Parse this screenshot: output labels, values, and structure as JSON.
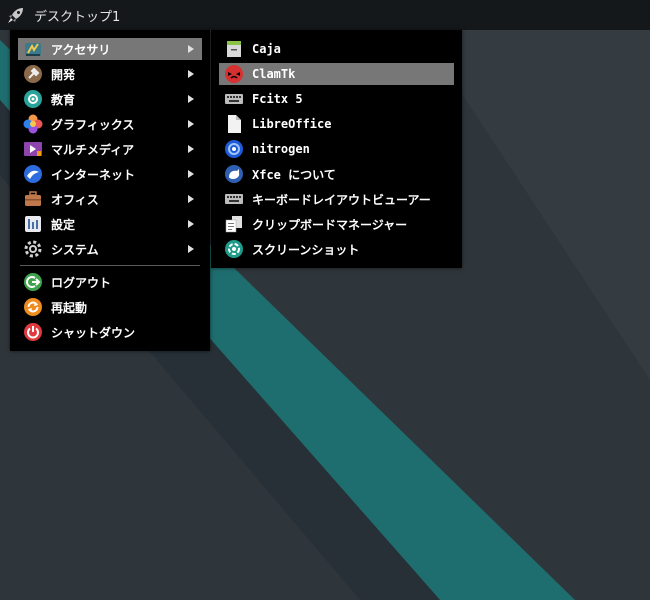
{
  "taskbar": {
    "title": "デスクトップ1",
    "icon": "rocket-icon"
  },
  "main_menu": {
    "items": [
      {
        "label": "アクセサリ",
        "icon": "accessories-icon",
        "submenu": true,
        "highlighted": true
      },
      {
        "label": "開発",
        "icon": "development-icon",
        "submenu": true
      },
      {
        "label": "教育",
        "icon": "education-icon",
        "submenu": true
      },
      {
        "label": "グラフィックス",
        "icon": "graphics-icon",
        "submenu": true
      },
      {
        "label": "マルチメディア",
        "icon": "multimedia-icon",
        "submenu": true
      },
      {
        "label": "インターネット",
        "icon": "internet-icon",
        "submenu": true
      },
      {
        "label": "オフィス",
        "icon": "office-icon",
        "submenu": true
      },
      {
        "label": "設定",
        "icon": "settings-icon",
        "submenu": true
      },
      {
        "label": "システム",
        "icon": "system-icon",
        "submenu": true
      }
    ],
    "session": [
      {
        "label": "ログアウト",
        "icon": "logout-icon"
      },
      {
        "label": "再起動",
        "icon": "restart-icon"
      },
      {
        "label": "シャットダウン",
        "icon": "shutdown-icon"
      }
    ]
  },
  "sub_menu": {
    "items": [
      {
        "label": "Caja",
        "icon": "file-manager-icon"
      },
      {
        "label": "ClamTk",
        "icon": "clamtk-icon",
        "highlighted": true
      },
      {
        "label": "Fcitx 5",
        "icon": "keyboard-icon"
      },
      {
        "label": "LibreOffice",
        "icon": "document-icon"
      },
      {
        "label": "nitrogen",
        "icon": "wallpaper-icon"
      },
      {
        "label": "Xfce について",
        "icon": "xfce-mouse-icon"
      },
      {
        "label": "キーボードレイアウトビューアー",
        "icon": "keyboard-layout-icon"
      },
      {
        "label": "クリップボードマネージャー",
        "icon": "clipboard-icon"
      },
      {
        "label": "スクリーンショット",
        "icon": "screenshot-icon"
      }
    ]
  },
  "colors": {
    "desktop_bg": "#2c3237",
    "stripe": "#1f6e6f",
    "menu_bg": "#000000",
    "highlight": "#777777",
    "taskbar_bg": "#15181b"
  }
}
